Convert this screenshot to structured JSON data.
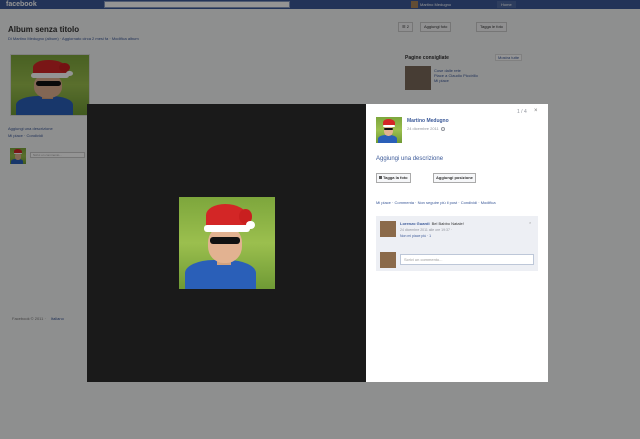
{
  "topbar": {
    "logo": "facebook",
    "search_placeholder": "",
    "user_name": "Martino Medugno",
    "home_label": "Home"
  },
  "album": {
    "title": "Album senza titolo",
    "subtitle": "Di Martino Medugno (album) · Aggiornato circa 2 mesi fa · Modifica album",
    "photo_count": "2",
    "add_photo_label": "Aggiungi foto",
    "tag_photo_label": "Tagga le foto",
    "side_link_1": "Aggiungi una descrizione",
    "side_link_2": "Mi piace · Condividi",
    "side_comment_placeholder": "Scrivi un commento...",
    "footer_text": "Facebook © 2011 ·",
    "footer_link": "Italiano"
  },
  "suggestions": {
    "title": "Pagine consigliate",
    "see_all": "Mostra tutte",
    "item_line1": "Cose dalle rete",
    "item_line2": "Piace a Claudio Piccirillo",
    "item_line3": "Mi piace"
  },
  "viewer": {
    "author_name": "Martino Medugno",
    "date": "24 dicembre 2011",
    "top_icons": "1 / 4",
    "close": "×",
    "add_description": "Aggiungi una descrizione",
    "tag_button": "Tagga la foto",
    "location_button": "Aggiungi posizione",
    "action_links": "Mi piace · Commenta · Non seguire più il post · Condividi · Modifica",
    "comment": {
      "author": "Lorenzo Guardi",
      "text": "Bel Babbo Natale!",
      "meta": "24 dicembre 2011 alle ore 19:37 ·",
      "like": "Non mi piace più · 1",
      "close": "×"
    },
    "comment_input_placeholder": "Scrivi un commento..."
  },
  "colors": {
    "facebook_blue": "#3b5998",
    "viewer_stage": "#1a1a1a",
    "panel_bg": "#ffffff"
  }
}
